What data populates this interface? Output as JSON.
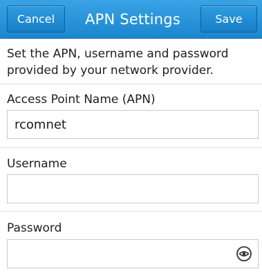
{
  "header": {
    "title": "APN Settings",
    "cancel_label": "Cancel",
    "save_label": "Save"
  },
  "description": "Set the APN, username and password provided by your network provider.",
  "fields": {
    "apn": {
      "label": "Access Point Name (APN)",
      "value": "rcomnet"
    },
    "username": {
      "label": "Username",
      "value": ""
    },
    "password": {
      "label": "Password",
      "value": ""
    }
  },
  "icons": {
    "reveal_password": "eye-icon"
  },
  "colors": {
    "titlebar": "#1b86cf",
    "button_border": "#0f5f97",
    "input_border": "#c9c9c9"
  }
}
